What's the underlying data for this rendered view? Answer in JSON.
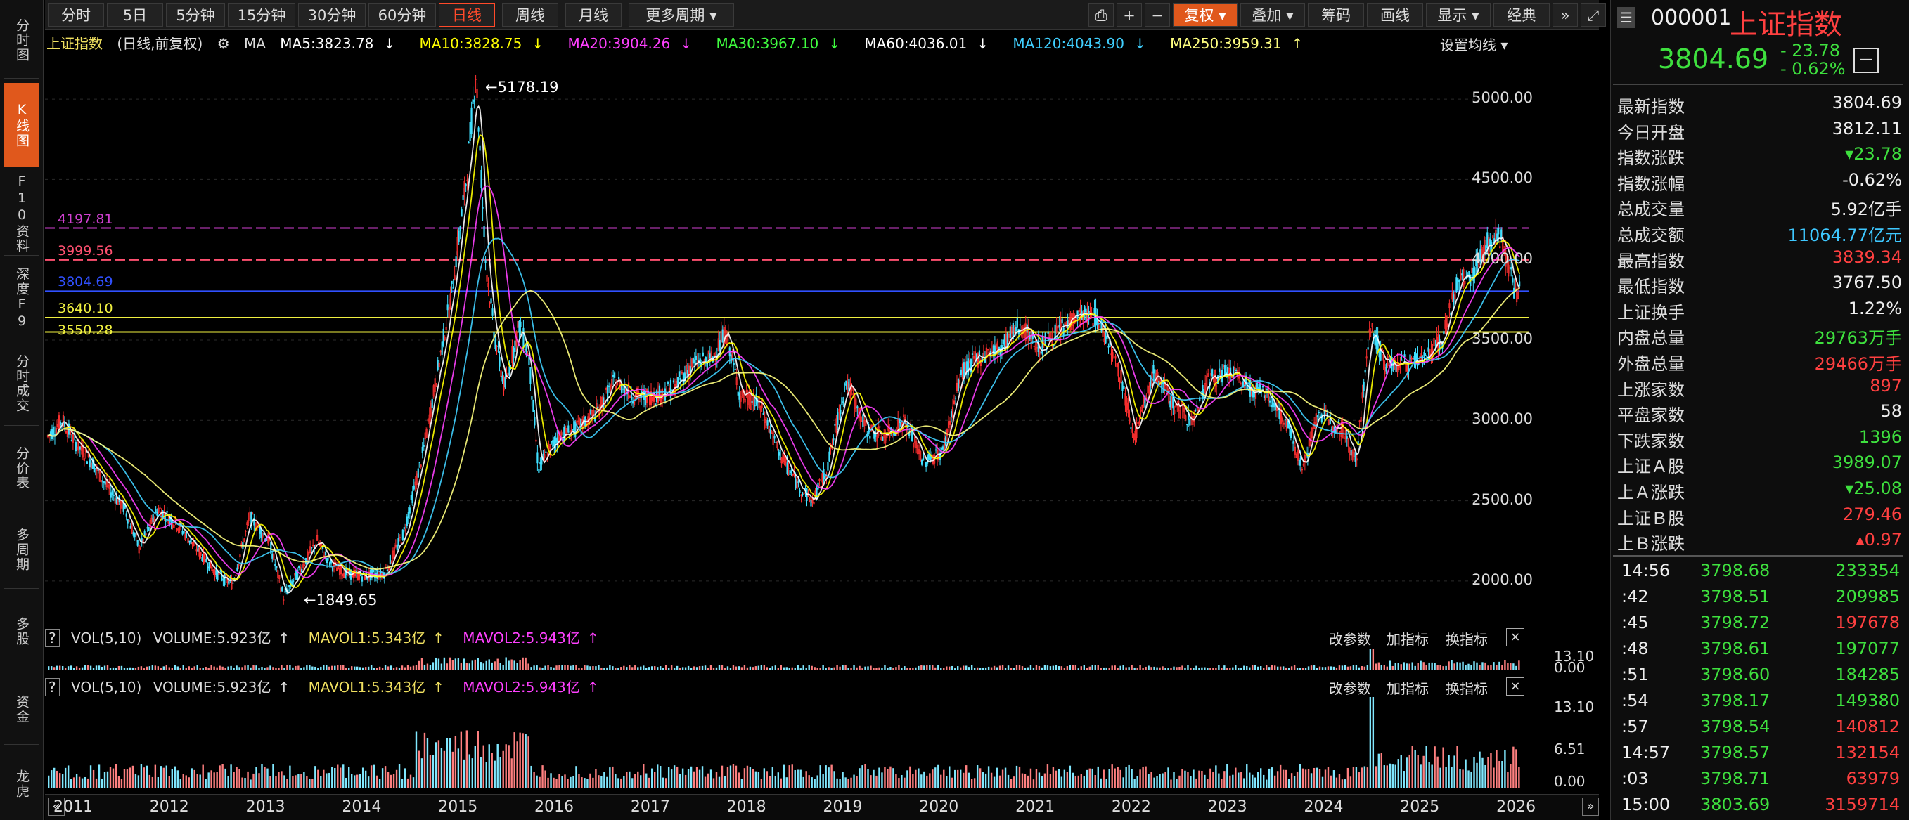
{
  "left_nav": [
    {
      "label": "分时图"
    },
    {
      "label": "K线图"
    },
    {
      "label": "F10资料"
    },
    {
      "label": "深度F9"
    },
    {
      "label": "分时成交"
    },
    {
      "label": "分价表"
    },
    {
      "label": "多周期"
    },
    {
      "label": "多股"
    },
    {
      "label": "资金"
    },
    {
      "label": "龙虎"
    }
  ],
  "period_tabs": [
    "分时",
    "5日",
    "5分钟",
    "15分钟",
    "30分钟",
    "60分钟",
    "日线",
    "周线",
    "月线",
    "更多周期 ▾"
  ],
  "toolbar": [
    "复权 ▾",
    "叠加 ▾",
    "筹码",
    "画线",
    "显示 ▾",
    "经典"
  ],
  "chart_header": {
    "name": "上证指数",
    "mode": "(日线,前复权)",
    "ma": "MA",
    "ma5": "MA5:3823.78",
    "ma10": "MA10:3828.75",
    "ma20": "MA20:3904.26",
    "ma30": "MA30:3967.10",
    "ma60": "MA60:4036.01",
    "ma120": "MA120:4043.90",
    "ma250": "MA250:3959.31",
    "settings": "设置均线 ▾",
    "arrow_down": "↓",
    "arrow_up": "↑"
  },
  "colors": {
    "ma5": "#ffffff",
    "ma10": "#ffff00",
    "ma20": "#ff40ff",
    "ma30": "#40ff40",
    "ma60": "#ffffff",
    "ma120": "#40d0ff",
    "ma250": "#ffff80",
    "up": "#ff3030",
    "down": "#40e0ff"
  },
  "chart_data": {
    "type": "candlestick",
    "title": "上证指数",
    "x_labels": [
      "2011",
      "2012",
      "2013",
      "2014",
      "2015",
      "2016",
      "2017",
      "2018",
      "2019",
      "2020",
      "2021",
      "2022",
      "2023",
      "2024",
      "2025",
      "2026"
    ],
    "y_ticks": [
      "5000.00",
      "4500.00",
      "4000.00",
      "3500.00",
      "3000.00",
      "2500.00",
      "2000.00"
    ],
    "ylim": [
      1750,
      5250
    ],
    "high_label": "5178.19",
    "low_label": "1849.65",
    "price_path": [
      [
        2011.0,
        2900
      ],
      [
        2011.15,
        3000
      ],
      [
        2011.3,
        2850
      ],
      [
        2011.45,
        2750
      ],
      [
        2011.6,
        2600
      ],
      [
        2011.8,
        2450
      ],
      [
        2011.95,
        2200
      ],
      [
        2012.15,
        2450
      ],
      [
        2012.35,
        2350
      ],
      [
        2012.55,
        2200
      ],
      [
        2012.75,
        2050
      ],
      [
        2012.92,
        1980
      ],
      [
        2013.1,
        2400
      ],
      [
        2013.3,
        2250
      ],
      [
        2013.45,
        1900
      ],
      [
        2013.6,
        2050
      ],
      [
        2013.8,
        2250
      ],
      [
        2013.95,
        2100
      ],
      [
        2014.1,
        2050
      ],
      [
        2014.3,
        2030
      ],
      [
        2014.5,
        2050
      ],
      [
        2014.7,
        2300
      ],
      [
        2014.9,
        2800
      ],
      [
        2015.05,
        3300
      ],
      [
        2015.2,
        3800
      ],
      [
        2015.35,
        4500
      ],
      [
        2015.45,
        5178
      ],
      [
        2015.55,
        4000
      ],
      [
        2015.65,
        3500
      ],
      [
        2015.75,
        3200
      ],
      [
        2015.9,
        3600
      ],
      [
        2016.0,
        3400
      ],
      [
        2016.1,
        2700
      ],
      [
        2016.3,
        2900
      ],
      [
        2016.5,
        2950
      ],
      [
        2016.7,
        3050
      ],
      [
        2016.9,
        3250
      ],
      [
        2017.1,
        3150
      ],
      [
        2017.3,
        3150
      ],
      [
        2017.5,
        3200
      ],
      [
        2017.7,
        3350
      ],
      [
        2017.9,
        3380
      ],
      [
        2018.05,
        3550
      ],
      [
        2018.2,
        3150
      ],
      [
        2018.4,
        3100
      ],
      [
        2018.6,
        2800
      ],
      [
        2018.8,
        2600
      ],
      [
        2018.95,
        2490
      ],
      [
        2019.1,
        2700
      ],
      [
        2019.3,
        3250
      ],
      [
        2019.5,
        2950
      ],
      [
        2019.7,
        2900
      ],
      [
        2019.9,
        3000
      ],
      [
        2020.1,
        2750
      ],
      [
        2020.3,
        2800
      ],
      [
        2020.5,
        3300
      ],
      [
        2020.7,
        3400
      ],
      [
        2020.9,
        3450
      ],
      [
        2021.1,
        3600
      ],
      [
        2021.3,
        3450
      ],
      [
        2021.5,
        3550
      ],
      [
        2021.7,
        3650
      ],
      [
        2021.9,
        3650
      ],
      [
        2022.1,
        3400
      ],
      [
        2022.3,
        2900
      ],
      [
        2022.5,
        3300
      ],
      [
        2022.7,
        3100
      ],
      [
        2022.9,
        3000
      ],
      [
        2023.05,
        3250
      ],
      [
        2023.3,
        3300
      ],
      [
        2023.5,
        3200
      ],
      [
        2023.7,
        3150
      ],
      [
        2023.9,
        2950
      ],
      [
        2024.05,
        2700
      ],
      [
        2024.2,
        3050
      ],
      [
        2024.45,
        2950
      ],
      [
        2024.6,
        2750
      ],
      [
        2024.75,
        3600
      ],
      [
        2024.9,
        3350
      ],
      [
        2025.1,
        3350
      ],
      [
        2025.3,
        3400
      ],
      [
        2025.5,
        3500
      ],
      [
        2025.65,
        3850
      ],
      [
        2025.8,
        3900
      ],
      [
        2025.95,
        4100
      ],
      [
        2026.1,
        4150
      ],
      [
        2026.25,
        3805
      ]
    ],
    "horizontal_lines": [
      {
        "label": "4197.81",
        "value": 4197.81,
        "color": "#d040d0"
      },
      {
        "label": "3999.56",
        "value": 3999.56,
        "color": "#ff5070"
      },
      {
        "label": "3804.69",
        "value": 3804.69,
        "color": "#3050ff"
      },
      {
        "label": "3640.10",
        "value": 3640.1,
        "color": "#f0f040"
      },
      {
        "label": "3550.28",
        "value": 3550.28,
        "color": "#f0f040"
      }
    ]
  },
  "volume_panel_1": {
    "help": "?",
    "vol": "VOL(5,10)",
    "volume": "VOLUME:5.923亿",
    "mavol1": "MAVOL1:5.343亿",
    "mavol2": "MAVOL2:5.943亿",
    "arrow_up": "↑",
    "btns": [
      "改参数",
      "加指标",
      "换指标"
    ],
    "close": "×",
    "y_top": "13.10",
    "y_bottom": "0.00"
  },
  "volume_panel_2": {
    "help": "?",
    "vol": "VOL(5,10)",
    "volume": "VOLUME:5.923亿",
    "mavol1": "MAVOL1:5.343亿",
    "mavol2": "MAVOL2:5.943亿",
    "arrow_up": "↑",
    "btns": [
      "改参数",
      "加指标",
      "换指标"
    ],
    "close": "×",
    "y_ticks": [
      "13.10",
      "6.51",
      "0.00"
    ]
  },
  "volume_data": {
    "max": 13.1,
    "spike_year": 2024.75,
    "spike_value": 13.1
  },
  "right_panel": {
    "code": "000001",
    "name": "上证指数",
    "price": "3804.69",
    "change": "- 23.78",
    "change_pct": "- 0.62%",
    "stats": [
      {
        "k": "最新指数",
        "v": "3804.69",
        "c": "white"
      },
      {
        "k": "今日开盘",
        "v": "3812.11",
        "c": "white"
      },
      {
        "k": "指数涨跌",
        "v": "▾23.78",
        "c": "green"
      },
      {
        "k": "指数涨幅",
        "v": "-0.62%",
        "c": "white"
      },
      {
        "k": "总成交量",
        "v": "5.92亿手",
        "c": "white"
      },
      {
        "k": "总成交额",
        "v": "11064.77亿元",
        "c": "cyan"
      },
      {
        "k": "最高指数",
        "v": "3839.34",
        "c": "red"
      },
      {
        "k": "最低指数",
        "v": "3767.50",
        "c": "white"
      },
      {
        "k": "上证换手",
        "v": "1.22%",
        "c": "white"
      },
      {
        "k": "内盘总量",
        "v": "29763万手",
        "c": "green"
      },
      {
        "k": "外盘总量",
        "v": "29466万手",
        "c": "red"
      },
      {
        "k": "上涨家数",
        "v": "897",
        "c": "red"
      },
      {
        "k": "平盘家数",
        "v": "58",
        "c": "white"
      },
      {
        "k": "下跌家数",
        "v": "1396",
        "c": "green"
      },
      {
        "k": "上证Ａ股",
        "v": "3989.07",
        "c": "green"
      },
      {
        "k": "上Ａ涨跌",
        "v": "▾25.08",
        "c": "green"
      },
      {
        "k": "上证Ｂ股",
        "v": "279.46",
        "c": "red"
      },
      {
        "k": "上Ｂ涨跌",
        "v": "▴0.97",
        "c": "red"
      }
    ],
    "trades": [
      {
        "t": "14:56",
        "p": "3798.68",
        "v": "233354",
        "c": "green"
      },
      {
        "t": ":42",
        "p": "3798.51",
        "v": "209985",
        "c": "green"
      },
      {
        "t": ":45",
        "p": "3798.72",
        "v": "197678",
        "c": "red"
      },
      {
        "t": ":48",
        "p": "3798.61",
        "v": "197077",
        "c": "green"
      },
      {
        "t": ":51",
        "p": "3798.60",
        "v": "184285",
        "c": "green"
      },
      {
        "t": ":54",
        "p": "3798.17",
        "v": "149380",
        "c": "green"
      },
      {
        "t": ":57",
        "p": "3798.54",
        "v": "140812",
        "c": "red"
      },
      {
        "t": "14:57",
        "p": "3798.57",
        "v": "132154",
        "c": "red"
      },
      {
        "t": ":03",
        "p": "3798.71",
        "v": "63979",
        "c": "red"
      },
      {
        "t": "15:00",
        "p": "3803.69",
        "v": "3159714",
        "c": "red"
      }
    ]
  }
}
